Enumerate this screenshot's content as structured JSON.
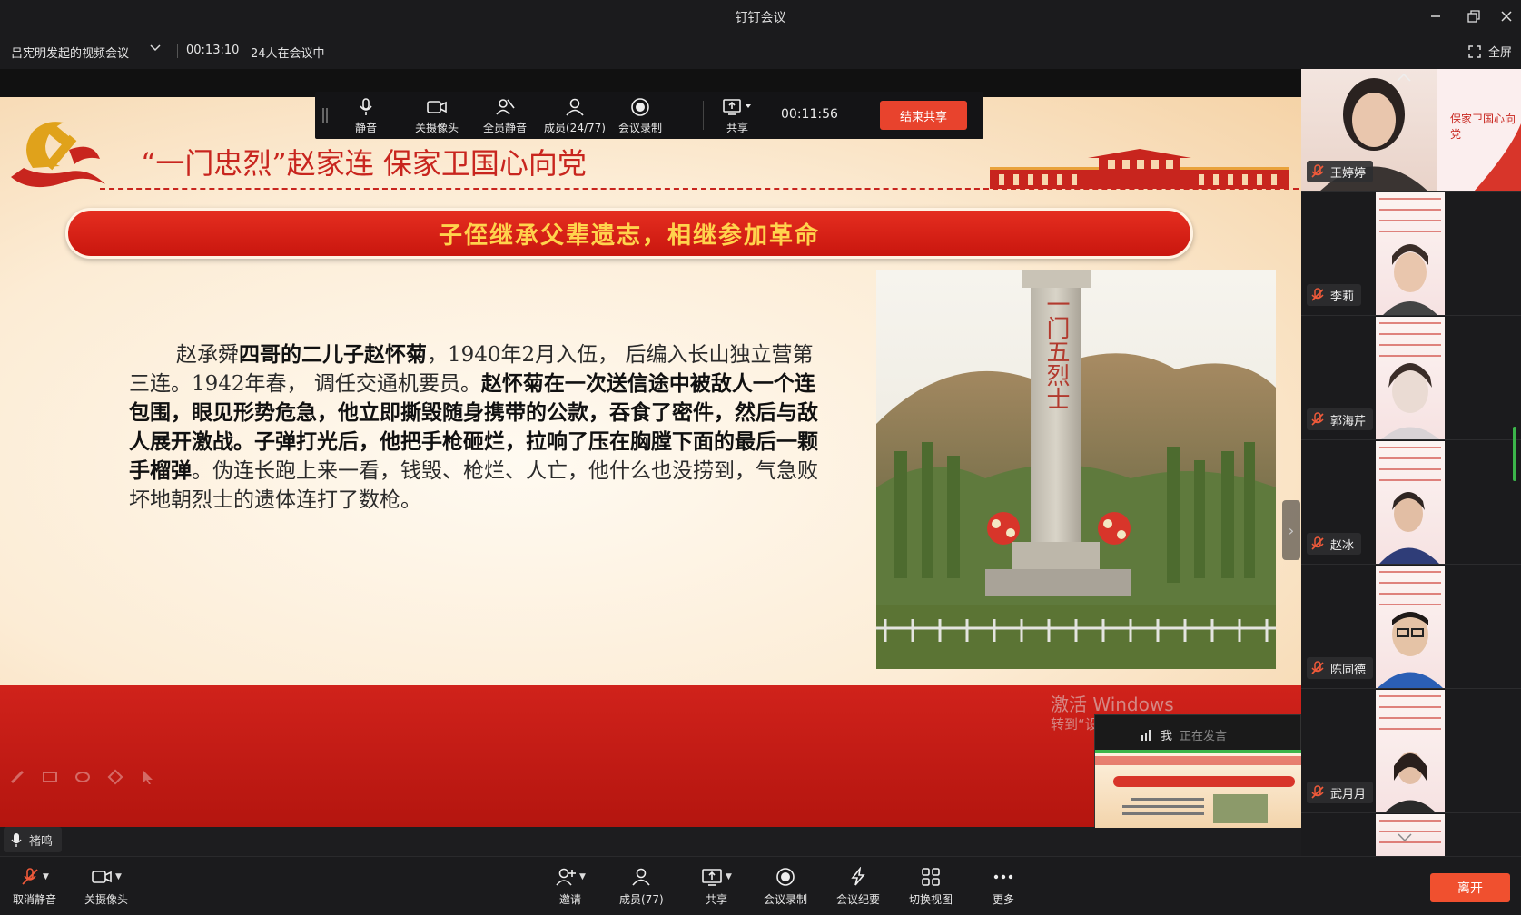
{
  "window": {
    "title": "钉钉会议"
  },
  "infobar": {
    "meeting_name": "吕宪明发起的视频会议",
    "elapsed": "00:13:10",
    "participants": "24人在会议中",
    "fullscreen_label": "全屏"
  },
  "share_toolbar": {
    "mute": "静音",
    "camera_off": "关摄像头",
    "mute_all": "全员静音",
    "members": "成员(24/77)",
    "record": "会议录制",
    "share": "共享",
    "timer": "00:11:56",
    "end_share": "结束共享"
  },
  "slide": {
    "heading": "“一门忠烈”赵家连 保家卫国心向党",
    "banner": "子侄继承父辈遗志，相继参加革命",
    "p1": "赵承舜",
    "p2": "四哥的二儿子赵怀菊",
    "p3": "，1940年2月入伍，  后编入长山独立营第三连。1942年春，  调任交通机要员。",
    "p4": "赵怀菊在一次送信途中被敌人一个连包围，眼见形势危急，他立即撕毁随身携带的公款，吞食了密件，然后与敌人展开激战。子弹打光后，他把手枪砸烂，拉响了压在胸膛下面的最后一颗手榴弹",
    "p5": "。伪连长跑上来一看，钱毁、枪烂、人亡，他什么也没捞到，气急败坏地朝烈士的遗体连打了数枪。",
    "monument": "一门五烈士"
  },
  "watermark": {
    "line1": "激活 Windows",
    "line2": "转到“设置”以激活 Windows"
  },
  "self_view": {
    "name": "我",
    "status": "正在发言"
  },
  "active_speaker": "褚鸣",
  "participants": [
    {
      "name": "王婷婷"
    },
    {
      "name": "李莉"
    },
    {
      "name": "郭海芹"
    },
    {
      "name": "赵冰"
    },
    {
      "name": "陈同德"
    },
    {
      "name": "武月月"
    }
  ],
  "sidebar_tile_slide": "保家卫国心向党",
  "bottombar": {
    "unmute": "取消静音",
    "camera_off": "关摄像头",
    "invite": "邀请",
    "members": "成员(77)",
    "share": "共享",
    "record": "会议录制",
    "minutes": "会议纪要",
    "switch_view": "切换视图",
    "more": "更多",
    "leave": "离开"
  },
  "colors": {
    "accent_red": "#e8432d",
    "slide_red": "#c8251e",
    "banner_text": "#ffd34d",
    "active_green": "#3bb54a"
  }
}
